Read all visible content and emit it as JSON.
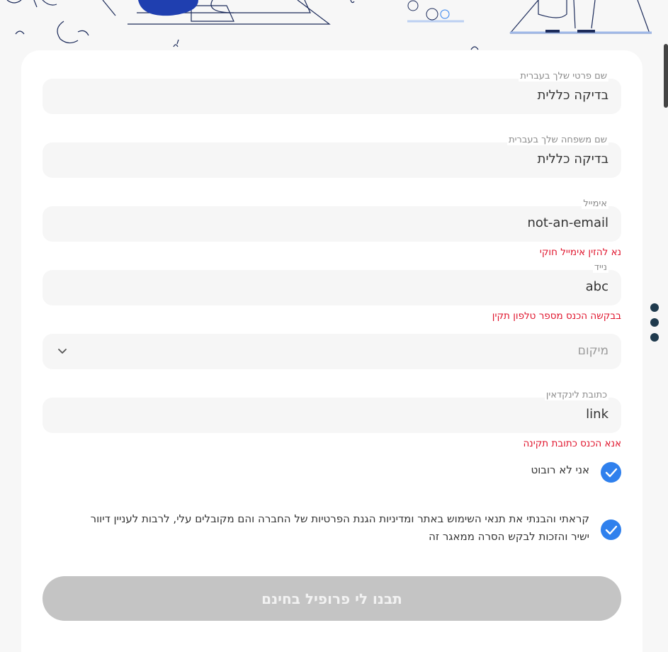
{
  "form": {
    "first_name": {
      "label": "שם פרטי שלך בעברית",
      "value": "בדיקה כללית"
    },
    "last_name": {
      "label": "שם משפחה שלך בעברית",
      "value": "בדיקה כללית"
    },
    "email": {
      "label": "אימייל",
      "value": "not-an-email",
      "error": "נא להזין אימייל חוקי"
    },
    "phone": {
      "label": "נייד",
      "value": "abc",
      "error": "בבקשה הכנס מספר טלפון תקין"
    },
    "location": {
      "placeholder": "מיקום"
    },
    "linkedin": {
      "label": "כתובת לינקדאין",
      "value": "link",
      "error": "אנא הכנס כתובת תקינה"
    },
    "robot_check": {
      "label": "אני לא רובוט",
      "checked": true
    },
    "terms_check": {
      "line1": "קראתי והבנתי את תנאי השימוש באתר ומדיניות הגנת הפרטיות של החברה והם מקובלים עלי, לרבות לעניין דיוור",
      "line2": "ישיר והזכות לבקש הסרה ממאגר זה",
      "checked": true
    },
    "submit_label": "תבנו לי פרופיל בחינם"
  },
  "colors": {
    "accent": "#2f80ed",
    "error": "#e0142c",
    "button_disabled": "#c4c4c4",
    "dots": "#1f3a4d"
  }
}
